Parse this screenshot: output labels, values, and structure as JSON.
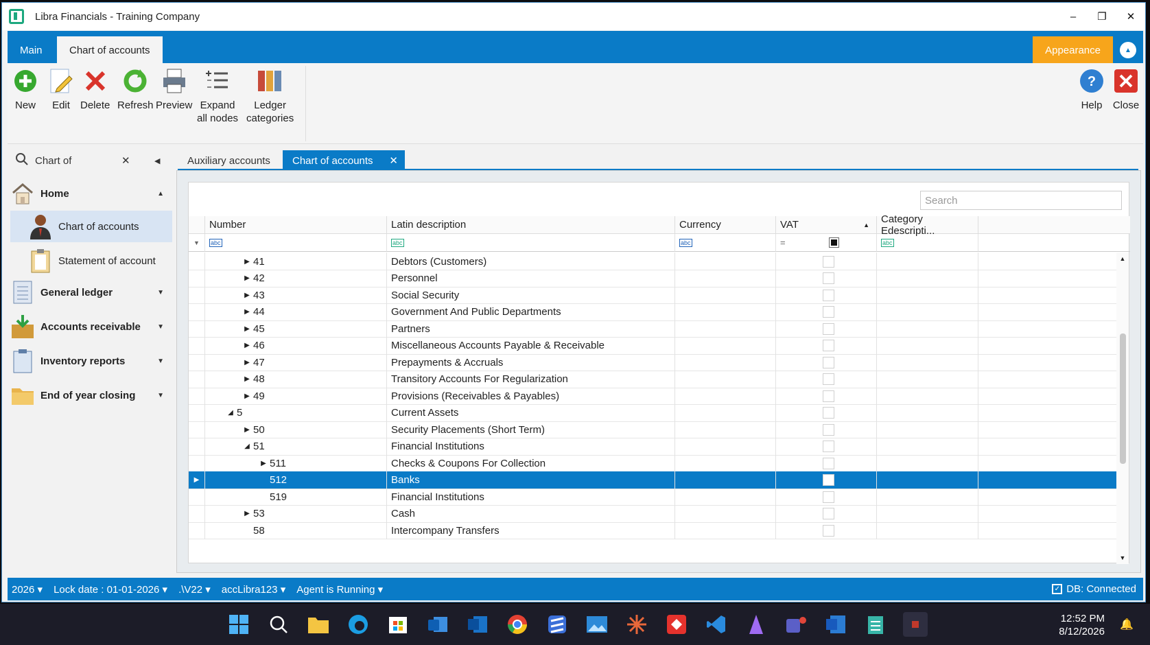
{
  "window": {
    "title": "Libra Financials - Training Company",
    "min": "–",
    "restore": "❐",
    "close": "✕"
  },
  "ribbon_tabs": {
    "main": "Main",
    "chart": "Chart of accounts",
    "appearance": "Appearance"
  },
  "ribbon": {
    "new": "New",
    "edit": "Edit",
    "delete": "Delete",
    "refresh": "Refresh",
    "preview": "Preview",
    "expand1": "Expand",
    "expand2": "all nodes",
    "ledger1": "Ledger",
    "ledger2": "categories",
    "help": "Help",
    "close": "Close"
  },
  "sidebar": {
    "search": "Chart of",
    "home": "Home",
    "chart": "Chart of accounts",
    "statement": "Statement of account",
    "general": "General ledger",
    "receivable": "Accounts receivable",
    "inventory": "Inventory reports",
    "endyear": "End of year closing"
  },
  "doctabs": {
    "aux": "Auxiliary accounts",
    "chart": "Chart of accounts"
  },
  "grid": {
    "search_placeholder": "Search",
    "columns": [
      "Number",
      "Latin description",
      "Currency",
      "VAT",
      "Category Edescripti..."
    ],
    "rows": [
      {
        "num": "41",
        "desc": "Debtors (Customers)",
        "level": 1,
        "exp": "right"
      },
      {
        "num": "42",
        "desc": "Personnel",
        "level": 1,
        "exp": "right"
      },
      {
        "num": "43",
        "desc": "Social Security",
        "level": 1,
        "exp": "right"
      },
      {
        "num": "44",
        "desc": "Government And Public Departments",
        "level": 1,
        "exp": "right"
      },
      {
        "num": "45",
        "desc": "Partners",
        "level": 1,
        "exp": "right"
      },
      {
        "num": "46",
        "desc": "Miscellaneous Accounts Payable & Receivable",
        "level": 1,
        "exp": "right"
      },
      {
        "num": "47",
        "desc": "Prepayments & Accruals",
        "level": 1,
        "exp": "right"
      },
      {
        "num": "48",
        "desc": "Transitory Accounts For Regularization",
        "level": 1,
        "exp": "right"
      },
      {
        "num": "49",
        "desc": "Provisions (Receivables & Payables)",
        "level": 1,
        "exp": "right"
      },
      {
        "num": "5",
        "desc": "Current Assets",
        "level": 0,
        "exp": "down"
      },
      {
        "num": "50",
        "desc": "Security Placements (Short Term)",
        "level": 1,
        "exp": "right"
      },
      {
        "num": "51",
        "desc": "Financial Institutions",
        "level": 1,
        "exp": "down"
      },
      {
        "num": "511",
        "desc": "Checks & Coupons For Collection",
        "level": 2,
        "exp": "right"
      },
      {
        "num": "512",
        "desc": "Banks",
        "level": 2,
        "exp": "",
        "sel": true
      },
      {
        "num": "519",
        "desc": "Financial Institutions",
        "level": 2,
        "exp": ""
      },
      {
        "num": "53",
        "desc": "Cash",
        "level": 1,
        "exp": "right"
      },
      {
        "num": "58",
        "desc": "Intercompany Transfers",
        "level": 1,
        "exp": ""
      }
    ]
  },
  "status": {
    "year": "2026",
    "lock": "Lock date : 01-01-2026",
    "path": ".\\V22",
    "user": "accLibra123",
    "agent": "Agent is Running",
    "db": "DB: Connected"
  },
  "clock": {
    "time": "12:52 PM",
    "date": "8/12/2026"
  },
  "colors": {
    "accent": "#0a7bc7",
    "appearance": "#f7a51b",
    "selected_row": "#0a7bc7"
  }
}
